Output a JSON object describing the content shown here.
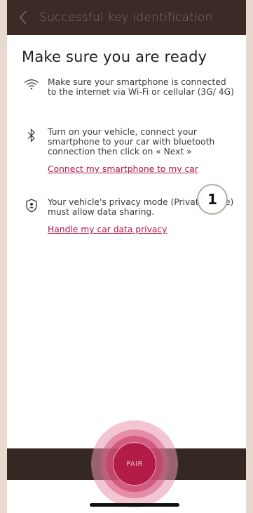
{
  "header": {
    "back_icon": "chevron-left-icon",
    "title": "Successful key identification"
  },
  "main": {
    "title": "Make sure you are ready",
    "requirements": [
      {
        "icon": "wifi-icon",
        "text": "Make sure your smartphone is connected to the internet via Wi-Fi or cellular (3G/ 4G)"
      },
      {
        "icon": "bluetooth-icon",
        "text": "Turn on your vehicle, connect your smartphone to your car with bluetooth connection then click on « Next »",
        "link": "Connect my smartphone to my car"
      },
      {
        "icon": "privacy-shield-icon",
        "text": "Your vehicle's privacy mode (Private Mode) must allow data sharing.",
        "link": "Handle my car data privacy"
      }
    ],
    "annotation_badge": "1"
  },
  "footer": {
    "pair_label": "PAIR"
  },
  "colors": {
    "header_bg": "#3b2a25",
    "accent": "#b5124a",
    "pair_button": "#b41c48",
    "bar_bg": "#352722"
  }
}
